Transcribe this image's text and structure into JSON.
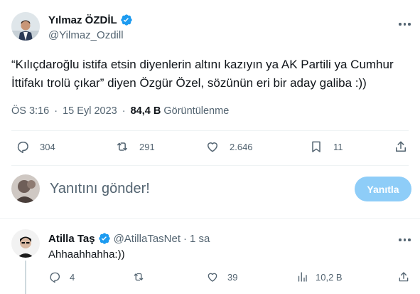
{
  "main_tweet": {
    "author_name": "Yılmaz ÖZDİL",
    "author_handle": "@Yilmaz_Ozdill",
    "text": "“Kılıçdaroğlu istifa etsin diyenlerin altını kazıyın ya AK Partili ya Cumhur İttifakı trolü çıkar” diyen Özgür Özel, sözünün eri bir aday galiba :))",
    "time": "ÖS 3:16",
    "separator": "·",
    "date": "15 Eyl 2023",
    "views_count": "84,4 B",
    "views_label": "Görüntülenme",
    "replies": "304",
    "retweets": "291",
    "likes": "2.646",
    "bookmarks": "11"
  },
  "reply_composer": {
    "placeholder": "Yanıtını gönder!",
    "button_label": "Yanıtla"
  },
  "reply_tweet": {
    "author_name": "Atilla Taş",
    "author_handle": "@AtillaTasNet",
    "separator": "·",
    "time_ago": "1 sa",
    "text": "Ahhaahhahha:))",
    "replies": "4",
    "retweets": "",
    "likes": "39",
    "views": "10,2 B"
  },
  "colors": {
    "accent": "#1d9bf0",
    "reply_button_bg": "#8ecdf8",
    "secondary_text": "#536471"
  }
}
